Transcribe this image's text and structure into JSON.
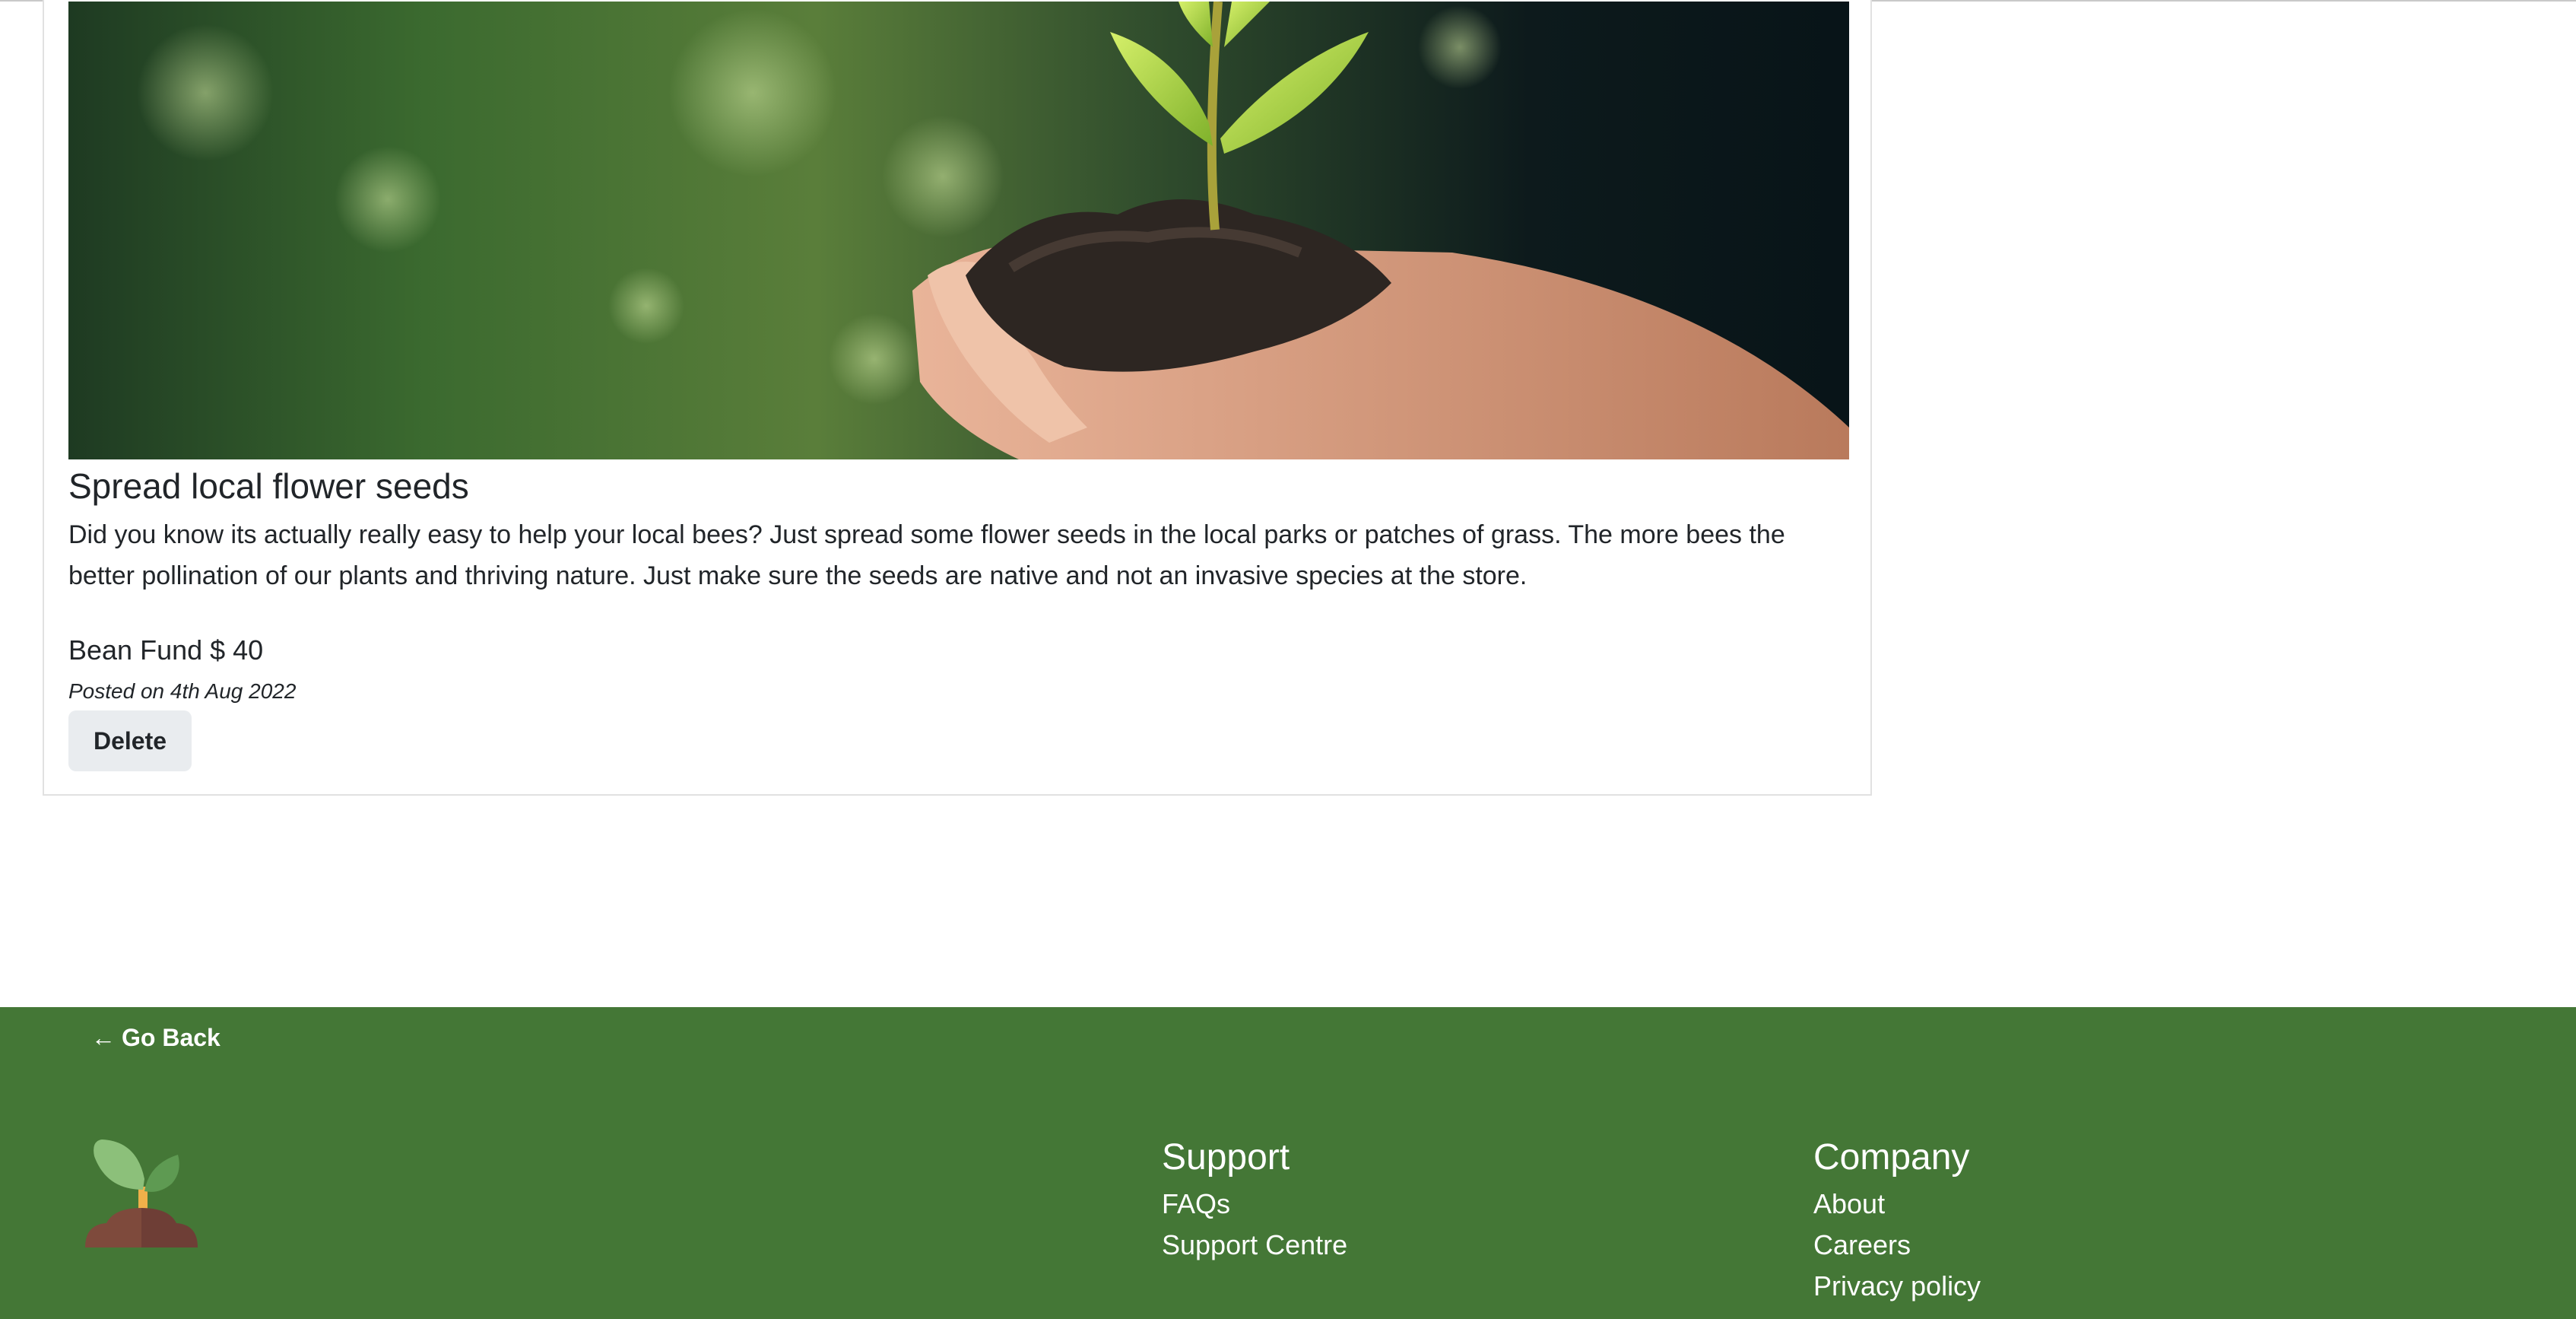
{
  "post": {
    "image_alt": "Hands holding soil with a seedling",
    "title": "Spread local flower seeds",
    "description": "Did you know its actually really easy to help your local bees? Just spread some flower seeds in the local parks or patches of grass. The more bees the better pollination of our plants and thriving nature. Just make sure the seeds are native and not an invasive species at the store.",
    "fund": "Bean Fund $ 40",
    "posted": "Posted on 4th Aug 2022",
    "delete_label": "Delete"
  },
  "footer": {
    "go_back_arrow": "←",
    "go_back_label": "Go Back",
    "support": {
      "heading": "Support",
      "links": [
        "FAQs",
        "Support Centre"
      ]
    },
    "company": {
      "heading": "Company",
      "links": [
        "About",
        "Careers",
        "Privacy policy"
      ]
    }
  },
  "colors": {
    "footer_bg": "#447736",
    "button_bg": "#e9ecef",
    "text": "#212529"
  }
}
